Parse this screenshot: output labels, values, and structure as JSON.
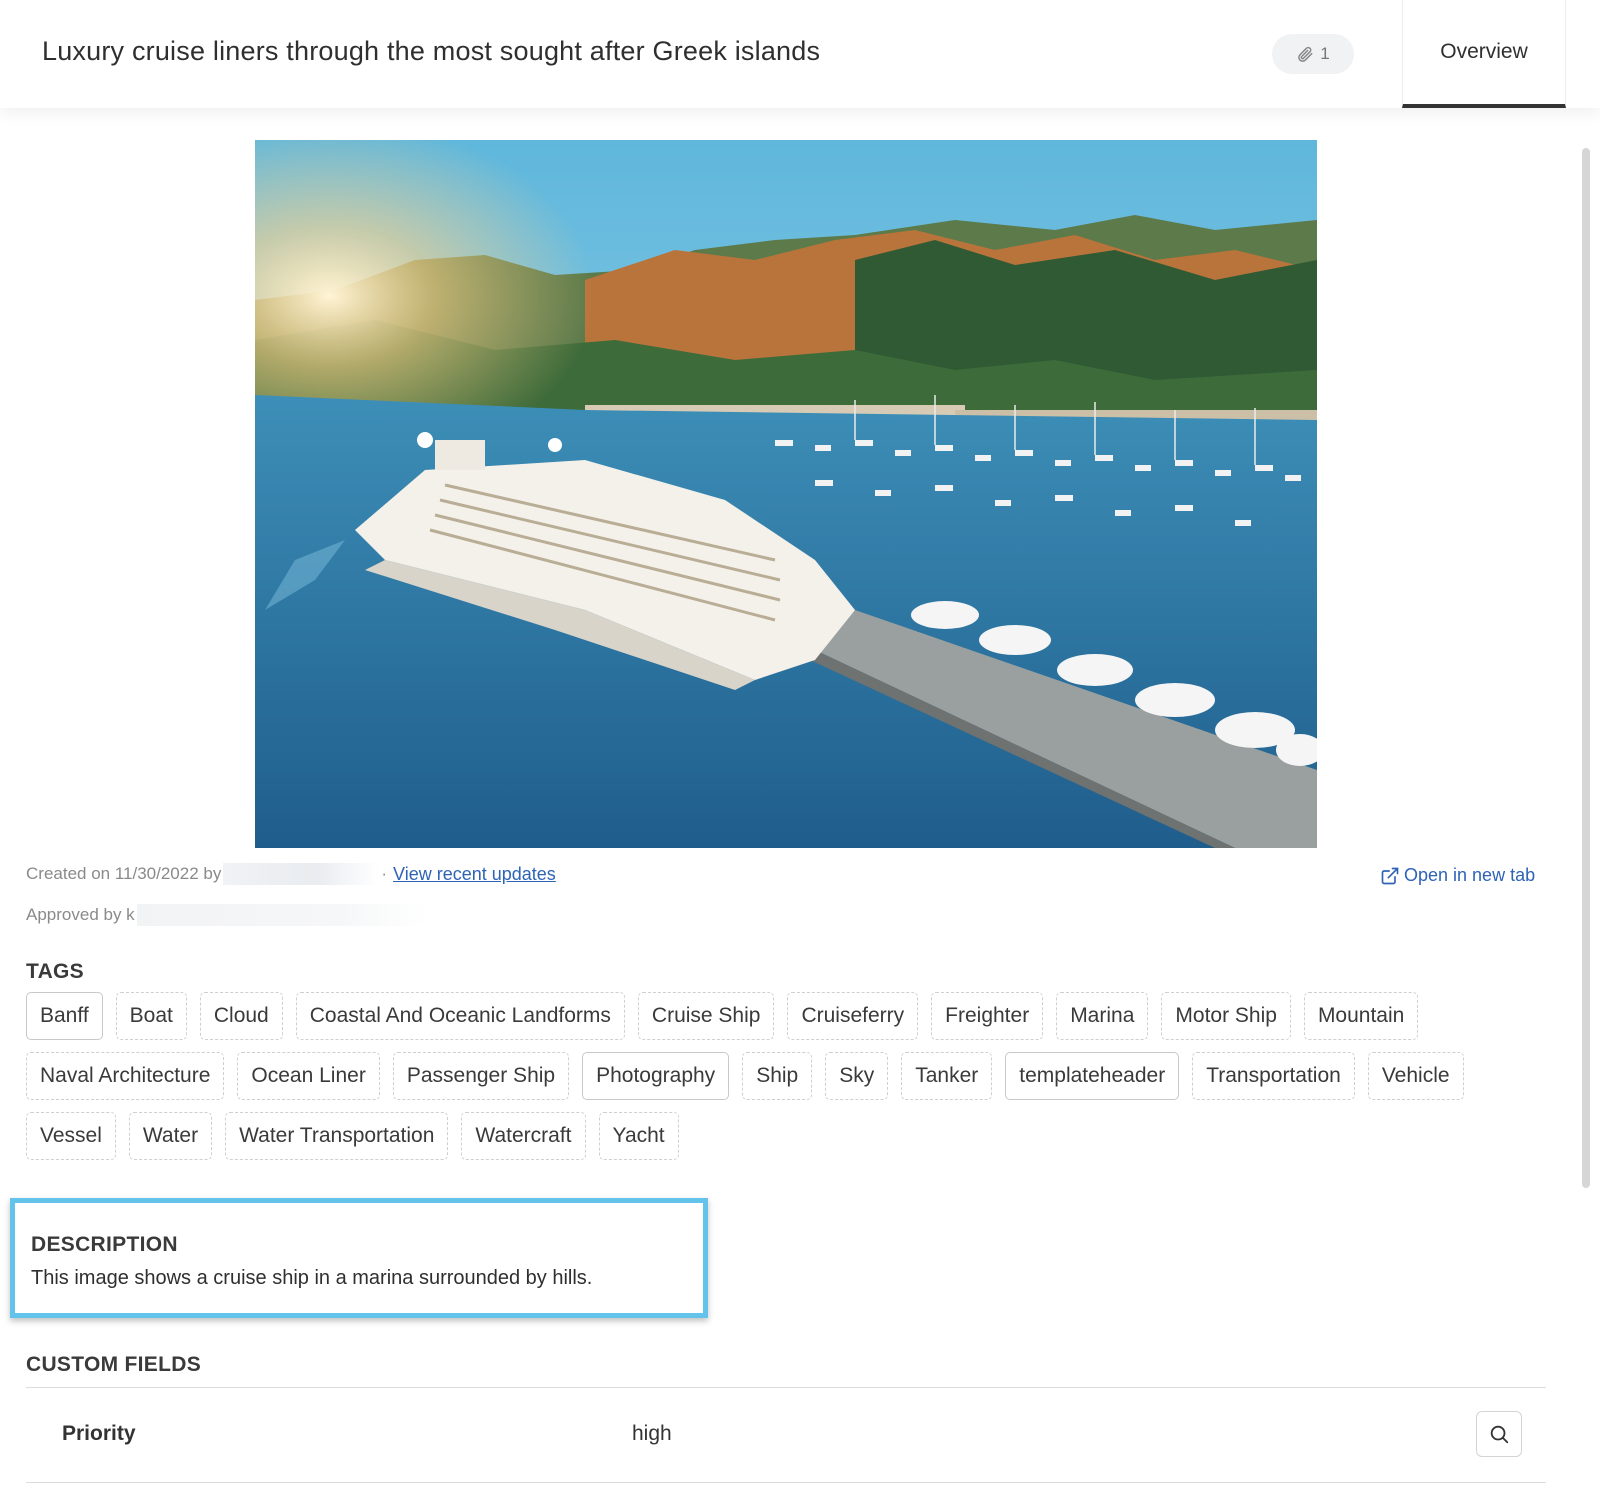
{
  "header": {
    "title": "Luxury cruise liners through the most sought after Greek islands",
    "attachment_count": "1",
    "tab_overview": "Overview"
  },
  "meta": {
    "created_prefix": "Created on 11/30/2022 by",
    "separator": "·",
    "view_updates": "View recent updates",
    "approved_prefix": "Approved by k",
    "open_new_tab": "Open in new tab"
  },
  "tags_section": {
    "title": "TAGS",
    "tags": [
      {
        "label": "Banff",
        "style": "solid"
      },
      {
        "label": "Boat",
        "style": "dashed"
      },
      {
        "label": "Cloud",
        "style": "dashed"
      },
      {
        "label": "Coastal And Oceanic Landforms",
        "style": "dashed"
      },
      {
        "label": "Cruise Ship",
        "style": "dashed"
      },
      {
        "label": "Cruiseferry",
        "style": "dashed"
      },
      {
        "label": "Freighter",
        "style": "dashed"
      },
      {
        "label": "Marina",
        "style": "dashed"
      },
      {
        "label": "Motor Ship",
        "style": "dashed"
      },
      {
        "label": "Mountain",
        "style": "dashed"
      },
      {
        "label": "Naval Architecture",
        "style": "dashed"
      },
      {
        "label": "Ocean Liner",
        "style": "dashed"
      },
      {
        "label": "Passenger Ship",
        "style": "dashed"
      },
      {
        "label": "Photography",
        "style": "solid"
      },
      {
        "label": "Ship",
        "style": "dashed"
      },
      {
        "label": "Sky",
        "style": "dashed"
      },
      {
        "label": "Tanker",
        "style": "dashed"
      },
      {
        "label": "templateheader",
        "style": "solid"
      },
      {
        "label": "Transportation",
        "style": "dashed"
      },
      {
        "label": "Vehicle",
        "style": "dashed"
      },
      {
        "label": "Vessel",
        "style": "dashed"
      },
      {
        "label": "Water",
        "style": "dashed"
      },
      {
        "label": "Water Transportation",
        "style": "dashed"
      },
      {
        "label": "Watercraft",
        "style": "dashed"
      },
      {
        "label": "Yacht",
        "style": "dashed"
      }
    ]
  },
  "description": {
    "title": "DESCRIPTION",
    "text": "This image shows a cruise ship in a marina surrounded by hills.",
    "highlight_color": "#64c3ea"
  },
  "custom_fields": {
    "title": "CUSTOM FIELDS",
    "rows": [
      {
        "label": "Priority",
        "value": "high"
      }
    ]
  },
  "icons": {
    "attachment": "paperclip-icon",
    "open_tab": "external-link-icon",
    "search": "search-icon"
  },
  "colors": {
    "link": "#2e63b6",
    "active_tab_underline": "#333333"
  }
}
